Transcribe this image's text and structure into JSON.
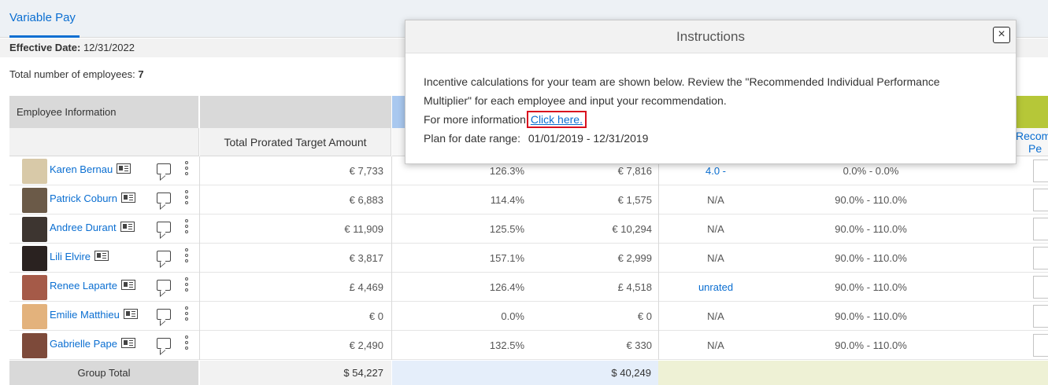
{
  "header": {
    "tab_label": "Variable Pay"
  },
  "effective": {
    "label": "Effective Date:",
    "value": "12/31/2022"
  },
  "summary": {
    "label": "Total number of employees:",
    "value": "7"
  },
  "table": {
    "group_header": "Employee Information",
    "col_prorated": "Total Prorated Target Amount",
    "col_recommended_partial": "Recom",
    "col_recommended_partial2": "Pe",
    "rows": [
      {
        "name": "Karen Bernau",
        "amount": "€ 7,733",
        "pct": "126.3%",
        "payout": "€ 7,816",
        "rating": "4.0 -",
        "rating_link": true,
        "range": "0.0% - 0.0%",
        "avatar": "#d8c9a8"
      },
      {
        "name": "Patrick Coburn",
        "amount": "€ 6,883",
        "pct": "114.4%",
        "payout": "€ 1,575",
        "rating": "N/A",
        "rating_link": false,
        "range": "90.0% - 110.0%",
        "avatar": "#6b5a48"
      },
      {
        "name": "Andree Durant",
        "amount": "€ 11,909",
        "pct": "125.5%",
        "payout": "€ 10,294",
        "rating": "N/A",
        "rating_link": false,
        "range": "90.0% - 110.0%",
        "avatar": "#3d3530"
      },
      {
        "name": "Lili Elvire",
        "amount": "€ 3,817",
        "pct": "157.1%",
        "payout": "€ 2,999",
        "rating": "N/A",
        "rating_link": false,
        "range": "90.0% - 110.0%",
        "avatar": "#2a2220"
      },
      {
        "name": "Renee Laparte",
        "amount": "£ 4,469",
        "pct": "126.4%",
        "payout": "£ 4,518",
        "rating": "unrated",
        "rating_link": true,
        "range": "90.0% - 110.0%",
        "avatar": "#a55a48"
      },
      {
        "name": "Emilie Matthieu",
        "amount": "€ 0",
        "pct": "0.0%",
        "payout": "€ 0",
        "rating": "N/A",
        "rating_link": false,
        "range": "90.0% - 110.0%",
        "avatar": "#e3b27c"
      },
      {
        "name": "Gabrielle Pape",
        "amount": "€ 2,490",
        "pct": "132.5%",
        "payout": "€ 330",
        "rating": "N/A",
        "rating_link": false,
        "range": "90.0% - 110.0%",
        "avatar": "#7d4a3a"
      }
    ],
    "footer": {
      "label": "Group Total",
      "prorated_total": "$ 54,227",
      "payout_total": "$ 40,249"
    }
  },
  "modal": {
    "title": "Instructions",
    "close": "×",
    "line1": "Incentive calculations for your team are shown below. Review the \"Recommended Individual Performance Multiplier\" for each employee and input your recommendation.",
    "more_info": "For more information",
    "link_text": "Click here.",
    "plan_label": "Plan for date range:",
    "plan_range": "01/01/2019 - 12/31/2019"
  }
}
